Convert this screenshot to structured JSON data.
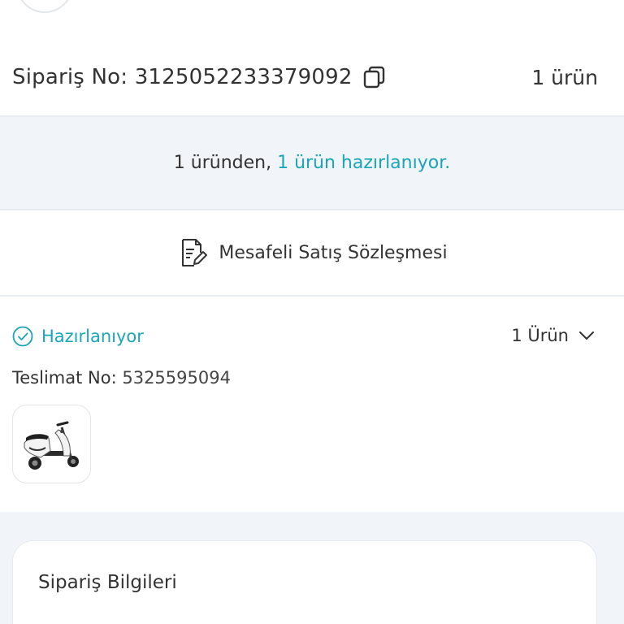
{
  "order": {
    "label_prefix": "Sipariş No:",
    "number": "3125052233379092",
    "item_count": "1 ürün"
  },
  "status_band": {
    "prefix": "1 üründen,",
    "highlight": "1 ürün hazırlanıyor."
  },
  "contract": {
    "label": "Mesafeli Satış Sözleşmesi"
  },
  "delivery": {
    "status": "Hazırlanıyor",
    "toggle_label": "1 Ürün",
    "tracking_label": "Teslimat No:",
    "tracking_number": "5325595094",
    "product_image": "electric-scooter-image"
  },
  "info_card": {
    "title": "Sipariş Bilgileri"
  },
  "colors": {
    "accent": "#1aa6b8",
    "band_bg": "#f1f4f8",
    "text": "#333333"
  },
  "icons": {
    "copy": "copy-icon",
    "contract": "document-edit-icon",
    "status": "check-circle-icon",
    "toggle": "chevron-down-icon"
  }
}
